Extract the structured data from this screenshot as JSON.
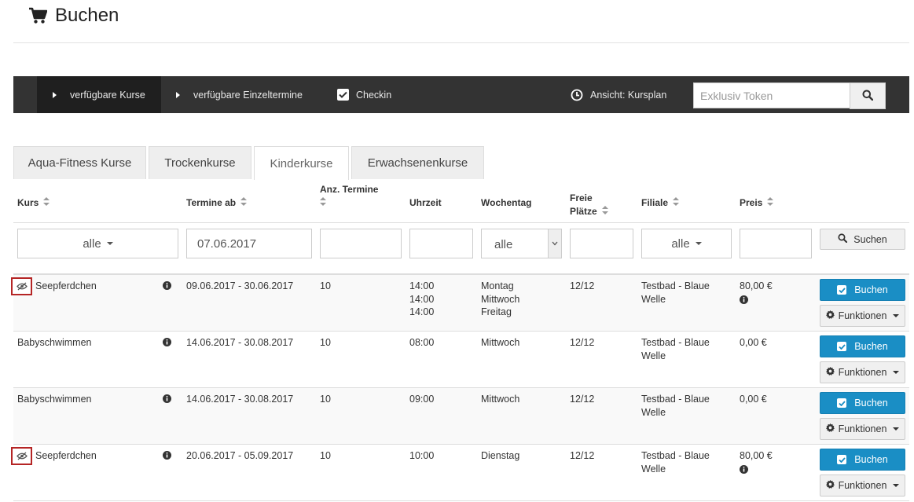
{
  "page": {
    "title": "Buchen"
  },
  "navbar": {
    "available_courses": "verfügbare Kurse",
    "available_single_dates": "verfügbare Einzeltermine",
    "checkin": "Checkin",
    "view": "Ansicht: Kursplan",
    "token_placeholder": "Exklusiv Token"
  },
  "tabs": [
    "Aqua-Fitness Kurse",
    "Trockenkurse",
    "Kinderkurse",
    "Erwachsenenkurse"
  ],
  "active_tab": "Kinderkurse",
  "columns": {
    "kurs": "Kurs",
    "termine_ab": "Termine ab",
    "anz_termine": "Anz. Termine",
    "uhrzeit": "Uhrzeit",
    "wochentag": "Wochentag",
    "freie_plaetze_1": "Freie",
    "freie_plaetze_2": "Plätze",
    "filiale": "Filiale",
    "preis": "Preis"
  },
  "filters": {
    "kurs": "alle",
    "termine_ab": "07.06.2017",
    "wochentag": "alle",
    "filiale": "alle",
    "search_label": "Suchen"
  },
  "buttons": {
    "book": "Buchen",
    "functions": "Funktionen"
  },
  "rows": [
    {
      "kurs": "Seepferdchen",
      "termine": "09.06.2017 - 30.06.2017",
      "anzahl": "10",
      "uhrzeit": [
        "14:00",
        "14:00",
        "14:00"
      ],
      "wochentag": [
        "Montag",
        "Mittwoch",
        "Freitag"
      ],
      "plaetze": "12/12",
      "filiale": [
        "Testbad - Blaue",
        "Welle"
      ],
      "preis": "80,00 €"
    },
    {
      "kurs": "Babyschwimmen",
      "termine": "14.06.2017 - 30.08.2017",
      "anzahl": "10",
      "uhrzeit": [
        "08:00"
      ],
      "wochentag": [
        "Mittwoch"
      ],
      "plaetze": "12/12",
      "filiale": [
        "Testbad - Blaue",
        "Welle"
      ],
      "preis": "0,00 €"
    },
    {
      "kurs": "Babyschwimmen",
      "termine": "14.06.2017 - 30.08.2017",
      "anzahl": "10",
      "uhrzeit": [
        "09:00"
      ],
      "wochentag": [
        "Mittwoch"
      ],
      "plaetze": "12/12",
      "filiale": [
        "Testbad - Blaue",
        "Welle"
      ],
      "preis": "0,00 €"
    },
    {
      "kurs": "Seepferdchen",
      "termine": "20.06.2017 - 05.09.2017",
      "anzahl": "10",
      "uhrzeit": [
        "10:00"
      ],
      "wochentag": [
        "Dienstag"
      ],
      "plaetze": "12/12",
      "filiale": [
        "Testbad - Blaue",
        "Welle"
      ],
      "preis": "80,00 €"
    }
  ],
  "colors": {
    "primary": "#1a8ec5",
    "navbar": "#333333",
    "highlight_border": "#b52525"
  },
  "icons": [
    "cart-icon",
    "caret-right-icon",
    "checkbox-icon",
    "clock-icon",
    "search-icon",
    "sort-icon",
    "eye-slash-icon",
    "info-icon",
    "gear-icon",
    "check-square-icon"
  ]
}
